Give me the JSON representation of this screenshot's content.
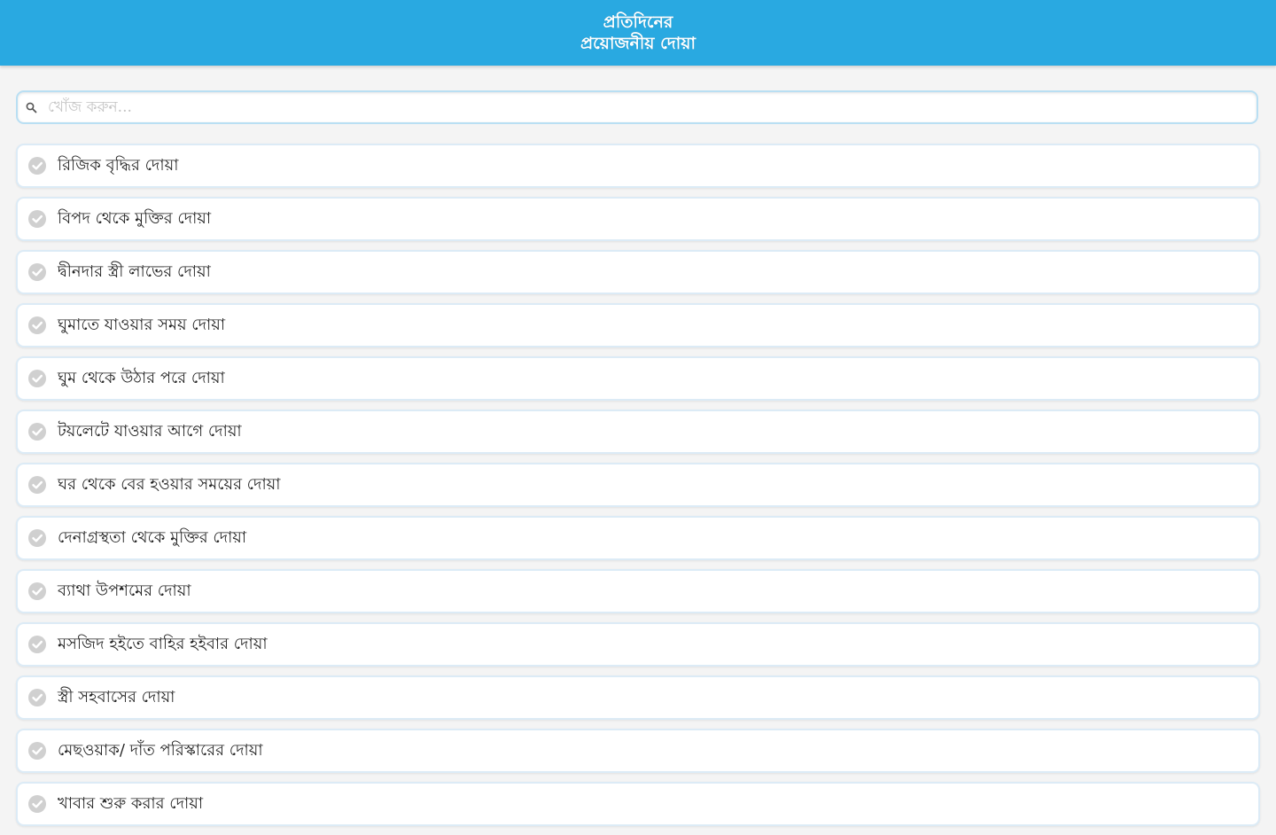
{
  "header": {
    "title_line1": "প্রতিদিনের",
    "title_line2": "প্রয়োজনীয় দোয়া"
  },
  "search": {
    "placeholder": "খোঁজ করুন...",
    "icon": "search-icon"
  },
  "colors": {
    "header_bg": "#29a9e1",
    "header_text": "#ffffff",
    "item_border": "#dcebf6",
    "check_icon": "#cccccc"
  },
  "items": [
    {
      "label": "রিজিক বৃদ্ধির দোয়া",
      "icon": "check-circle-icon"
    },
    {
      "label": "বিপদ থেকে মুক্তির দোয়া",
      "icon": "check-circle-icon"
    },
    {
      "label": "দ্বীনদার স্ত্রী লাভের দোয়া",
      "icon": "check-circle-icon"
    },
    {
      "label": "ঘুমাতে যাওয়ার সময় দোয়া",
      "icon": "check-circle-icon"
    },
    {
      "label": "ঘুম থেকে উঠার পরে দোয়া",
      "icon": "check-circle-icon"
    },
    {
      "label": "টয়লেটে যাওয়ার আগে দোয়া",
      "icon": "check-circle-icon"
    },
    {
      "label": "ঘর থেকে বের হওয়ার সময়ের দোয়া",
      "icon": "check-circle-icon"
    },
    {
      "label": "দেনাগ্রস্থতা থেকে মুক্তির দোয়া",
      "icon": "check-circle-icon"
    },
    {
      "label": "ব্যাথা উপশমের দোয়া",
      "icon": "check-circle-icon"
    },
    {
      "label": "মসজিদ হইতে বাহির হইবার দোয়া",
      "icon": "check-circle-icon"
    },
    {
      "label": "স্ত্রী সহবাসের দোয়া",
      "icon": "check-circle-icon"
    },
    {
      "label": "মেছওয়াক/ দাঁত পরিস্কারের দোয়া",
      "icon": "check-circle-icon"
    },
    {
      "label": "খাবার শুরু করার দোয়া",
      "icon": "check-circle-icon"
    }
  ]
}
